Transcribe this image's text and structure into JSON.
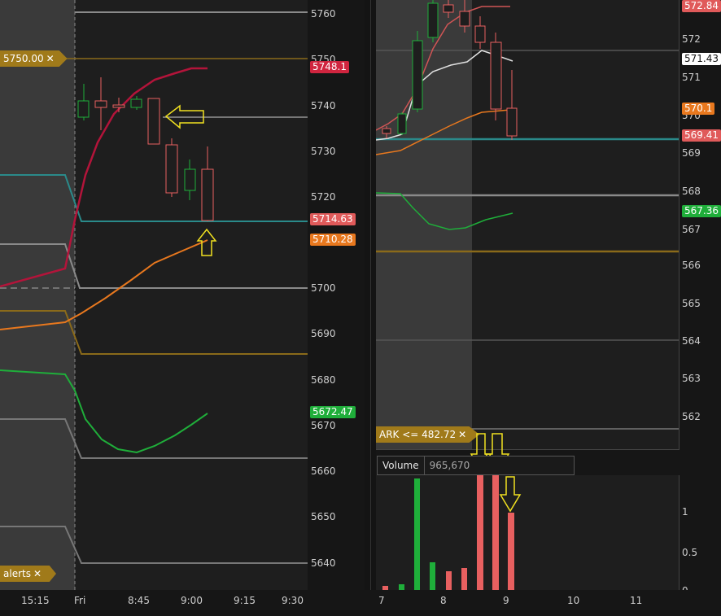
{
  "left_chart": {
    "price_axis": [
      "5760",
      "5750",
      "5740",
      "5730",
      "5720",
      "5710",
      "5700",
      "5690",
      "5680",
      "5670",
      "5660",
      "5650",
      "5640"
    ],
    "time_axis": [
      "15:15",
      "Fri",
      "8:45",
      "9:00",
      "9:15",
      "9:30"
    ],
    "price_tags": [
      {
        "label": "5748.1",
        "color": "#d0253f"
      },
      {
        "label": "5714.63",
        "color": "#e05a5a"
      },
      {
        "label": "5710.28",
        "color": "#e8781e"
      },
      {
        "label": "5672.47",
        "color": "#1fae3a"
      }
    ],
    "alert_top": {
      "label": "5750.00",
      "close": "✕"
    },
    "alert_bottom": {
      "label": "alerts",
      "close": "✕"
    }
  },
  "right_chart": {
    "price_axis": [
      "572",
      "571",
      "570",
      "569",
      "568",
      "567",
      "566",
      "565",
      "564",
      "563",
      "562"
    ],
    "time_axis": [
      "7",
      "8",
      "9",
      "10",
      "11"
    ],
    "price_tags": [
      {
        "label": "572.84",
        "color": "#e05a5a"
      },
      {
        "label": "571.43",
        "color": "#ffffff"
      },
      {
        "label": "570.1",
        "color": "#e8781e"
      },
      {
        "label": "569.41",
        "color": "#e05a5a"
      },
      {
        "label": "567.36",
        "color": "#1fae3a"
      }
    ],
    "alert": {
      "label": "ARK <= 482.72",
      "close": "✕"
    }
  },
  "volume": {
    "label": "Volume",
    "value": "965,670",
    "axis": [
      "1",
      "0.5",
      "0"
    ]
  },
  "colors": {
    "background": "#1e1e1e",
    "shaded": "#3a3a3a",
    "up": "#1fae3a",
    "down": "#e86060",
    "crimson": "#b3143a",
    "orange": "#e8781e",
    "teal": "#2a8a8a",
    "gold": "#8a6a1a",
    "annotation": "#f0e020"
  }
}
